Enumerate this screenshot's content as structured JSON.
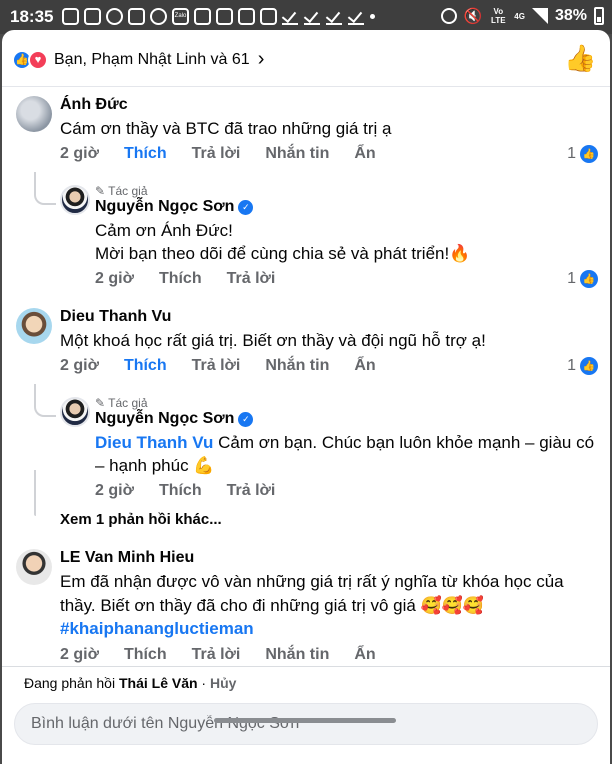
{
  "status_bar": {
    "time": "18:35",
    "zalo": "Zalo",
    "lte": "Vo LTE",
    "network": "4G",
    "battery": "38%"
  },
  "header": {
    "reaction_summary": "Bạn, Phạm Nhật Linh và 61",
    "chevron": "›"
  },
  "author_tag": "Tác giả",
  "comments": [
    {
      "name": "Ánh Đức",
      "text": "Cám ơn thầy và BTC  đã trao những giá trị ạ",
      "actions": [
        "2 giờ",
        "Thích",
        "Trả lời",
        "Nhắn tin",
        "Ẩn"
      ],
      "likes": "1",
      "reply": {
        "name": "Nguyễn Ngọc Sơn",
        "lines": [
          "Cảm ơn Ánh Đức!",
          "Mời bạn theo dõi để cùng chia sẻ và phát triển!🔥"
        ],
        "actions": [
          "2 giờ",
          "Thích",
          "Trả lời"
        ],
        "likes": "1"
      }
    },
    {
      "name": "Dieu Thanh Vu",
      "text": "Một khoá học rất giá trị. Biết ơn thầy và đội ngũ hỗ trợ ạ!",
      "actions": [
        "2 giờ",
        "Thích",
        "Trả lời",
        "Nhắn tin",
        "Ẩn"
      ],
      "likes": "1",
      "reply": {
        "name": "Nguyễn Ngọc Sơn",
        "mention": "Dieu Thanh Vu",
        "line1": "  Cảm ơn bạn. Chúc bạn luôn khỏe mạnh – giàu có",
        "line2": "– hạnh phúc 💪",
        "actions": [
          "2 giờ",
          "Thích",
          "Trả lời"
        ]
      },
      "more_replies": "Xem 1 phản hồi khác..."
    },
    {
      "name": "LE Van Minh Hieu",
      "lines": [
        "Em đã nhận được vô vàn những giá trị rất ý nghĩa từ khóa học của",
        "thầy. Biết ơn thầy đã cho đi những giá trị vô giá 🥰🥰🥰"
      ],
      "hashtag": "#khaiphanangluctieman",
      "actions": [
        "2 giờ",
        "Thích",
        "Trả lời",
        "Nhắn tin",
        "Ẩn"
      ]
    }
  ],
  "composer": {
    "replying_prefix": "Đang phản hồi ",
    "replying_name": "Thái Lê Văn",
    "separator": " · ",
    "cancel": "Hủy",
    "placeholder": "Bình luận dưới tên Nguyễn Ngọc Sơn"
  }
}
